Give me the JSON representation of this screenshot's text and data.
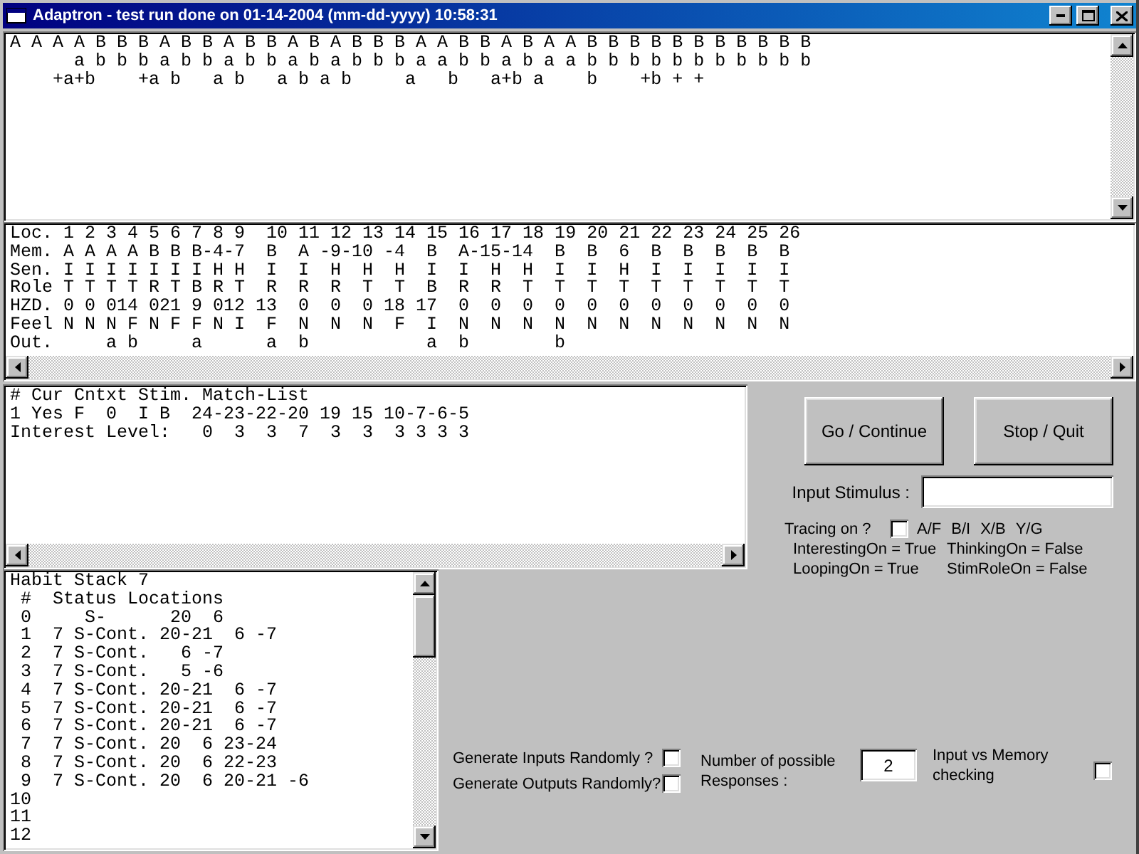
{
  "window": {
    "title": "Adaptron - test run done on 01-14-2004 (mm-dd-yyyy) 10:58:31"
  },
  "sequence_pane": {
    "lines": [
      "A A A A B B B A B B A B B A B A B B B A A B B A B A A B B B B B B B B B B B",
      "      a b b b a b b a b b a b a b b b a a b b a b a a b b b b b b b b b b b",
      "    +a+b    +a b   a b   a b a b     a   b   a+b a    b    +b + +"
    ]
  },
  "memory_table": {
    "lines": [
      "Loc. 1 2 3 4 5 6 7 8 9  10 11 12 13 14 15 16 17 18 19 20 21 22 23 24 25 26",
      "Mem. A A A A B B B-4-7  B  A -9-10 -4  B  A-15-14  B  B  6  B  B  B  B  B",
      "Sen. I I I I I I I H H  I  I  H  H  H  I  I  H  H  I  I  H  I  I  I  I  I",
      "Role T T T T R T B R T  R  R  R  T  T  B  R  R  T  T  T  T  T  T  T  T  T",
      "HZD. 0 0 014 021 9 012 13  0  0  0 18 17  0  0  0  0  0  0  0  0  0  0  0",
      "Feel N N N F N F F N I  F  N  N  N  F  I  N  N  N  N  N  N  N  N  N  N  N",
      "Out.     a b     a      a  b           a  b        b"
    ]
  },
  "match_pane": {
    "lines": [
      "# Cur Cntxt Stim. Match-List",
      "1 Yes F  0  I B  24-23-22-20 19 15 10-7-6-5",
      "Interest Level:   0  3  3  7  3  3  3 3 3 3"
    ]
  },
  "buttons": [
    {
      "label": "Go / Continue"
    },
    {
      "label": "Stop / Quit"
    }
  ],
  "input_stimulus": {
    "label": "Input Stimulus :"
  },
  "tracing": {
    "label": "Tracing on ?",
    "checked": false,
    "legend": [
      "A/F",
      "B/I",
      "X/B",
      "Y/G"
    ]
  },
  "flags": [
    "InterestingOn = True",
    "ThinkingOn = False",
    "LoopingOn = True",
    "StimRoleOn = False"
  ],
  "habit_stack": {
    "lines": [
      "Habit Stack 7",
      " #  Status Locations",
      " 0     S-      20  6",
      " 1  7 S-Cont. 20-21  6 -7",
      " 2  7 S-Cont.   6 -7",
      " 3  7 S-Cont.   5 -6",
      " 4  7 S-Cont. 20-21  6 -7",
      " 5  7 S-Cont. 20-21  6 -7",
      " 6  7 S-Cont. 20-21  6 -7",
      " 7  7 S-Cont. 20  6 23-24",
      " 8  7 S-Cont. 20  6 22-23",
      " 9  7 S-Cont. 20  6 20-21 -6",
      "10",
      "11",
      "12"
    ]
  },
  "random_options": [
    {
      "label": "Generate Inputs Randomly ?",
      "checked": false
    },
    {
      "label": "Generate Outputs Randomly?",
      "checked": false
    }
  ],
  "responses": {
    "label": "Number of possible Responses :",
    "value": "2"
  },
  "memory_check": {
    "label": "Input vs Memory checking",
    "checked": false
  }
}
